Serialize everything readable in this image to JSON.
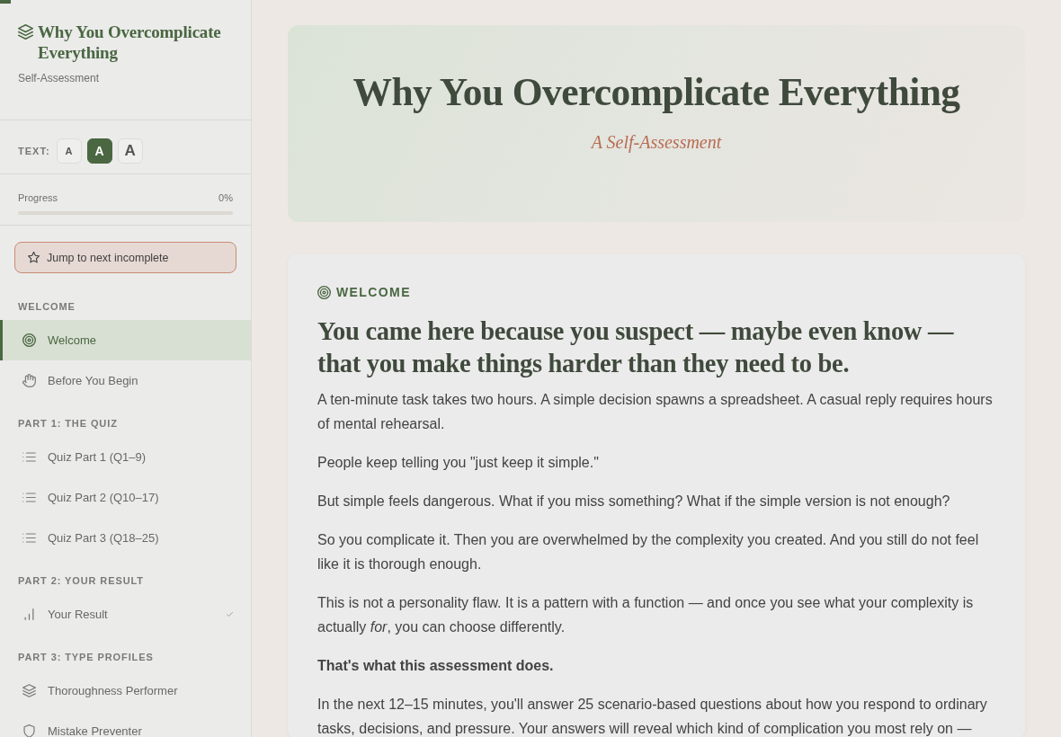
{
  "reading_progress": {
    "level": 0.01
  },
  "sidebar": {
    "title": "Why You Overcomplicate Everything",
    "subtitle": "Self-Assessment",
    "text_size": {
      "label": "TEXT:",
      "options": [
        {
          "label": "A",
          "kind": "small",
          "selected": false
        },
        {
          "label": "A",
          "kind": "medium",
          "selected": true
        },
        {
          "label": "A",
          "kind": "large",
          "selected": false
        }
      ]
    },
    "progress": {
      "label": "Progress",
      "reading": "0%",
      "level": 0
    },
    "jump_button": "Jump to next incomplete",
    "sections": [
      {
        "heading": "WELCOME",
        "items": [
          {
            "label": "Welcome",
            "kind": "welcome",
            "selected": true,
            "done": false
          },
          {
            "label": "Before You Begin",
            "kind": "primer",
            "selected": false,
            "done": false
          }
        ]
      },
      {
        "heading": "PART 1: THE QUIZ",
        "items": [
          {
            "label": "Quiz Part 1 (Q1–9)",
            "kind": "quiz",
            "selected": false,
            "done": false
          },
          {
            "label": "Quiz Part 2 (Q10–17)",
            "kind": "quiz",
            "selected": false,
            "done": false
          },
          {
            "label": "Quiz Part 3 (Q18–25)",
            "kind": "quiz",
            "selected": false,
            "done": false
          }
        ]
      },
      {
        "heading": "PART 2: YOUR RESULT",
        "items": [
          {
            "label": "Your Result",
            "kind": "result",
            "selected": false,
            "done": true
          }
        ]
      },
      {
        "heading": "PART 3: TYPE PROFILES",
        "items": [
          {
            "label": "Thoroughness Performer",
            "kind": "performer",
            "selected": false,
            "done": false
          },
          {
            "label": "Mistake Preventer",
            "kind": "preventer",
            "selected": false,
            "done": false
          }
        ]
      }
    ]
  },
  "hero": {
    "title": "Why You Overcomplicate Everything",
    "subtitle": "A Self-Assessment"
  },
  "section": {
    "label": "WELCOME",
    "heading": "You came here because you suspect — maybe even know — that you make things harder than they need to be.",
    "paragraphs": [
      {
        "text": "A ten-minute task takes two hours. A simple decision spawns a spreadsheet. A casual reply requires hours of mental rehearsal.",
        "strong": false
      },
      {
        "text": "People keep telling you \"just keep it simple.\"",
        "strong": false
      },
      {
        "text": "But simple feels dangerous. What if you miss something? What if the simple version is not enough?",
        "strong": false
      },
      {
        "text": "So you complicate it. Then you are overwhelmed by the complexity you created. And you still do not feel like it is thorough enough.",
        "strong": false
      },
      {
        "text": "This is not a personality flaw. It is a pattern with a function — and once you see what your complexity is actually *for*, you can choose differently.",
        "strong": false
      },
      {
        "text": "That's what this assessment does.",
        "strong": true
      },
      {
        "text": "In the next 12–15 minutes, you'll answer 25 scenario-based questions about how you respond to ordinary tasks, decisions, and pressure. Your answers will reveal which kind of complication you most rely on —",
        "strong": false
      }
    ]
  }
}
